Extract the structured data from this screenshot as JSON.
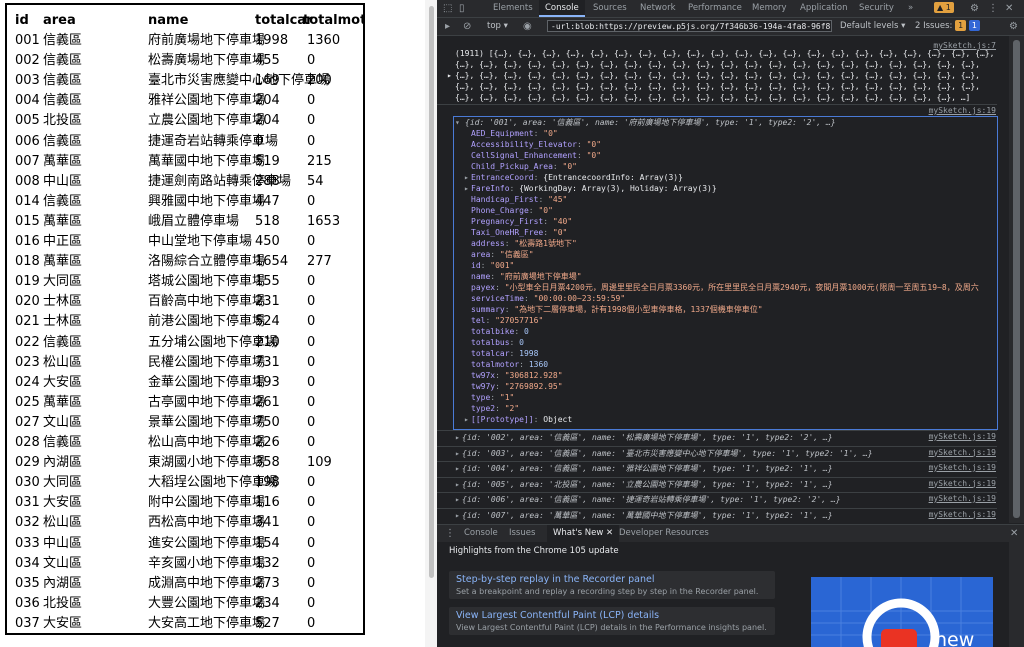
{
  "canvas": {
    "headers": [
      "id",
      "area",
      "name",
      "totalcar",
      "totalmotor"
    ],
    "rows": [
      [
        "001",
        "信義區",
        "府前廣場地下停車場",
        "1998",
        "1360"
      ],
      [
        "002",
        "信義區",
        "松壽廣場地下停車場",
        "455",
        "0"
      ],
      [
        "003",
        "信義區",
        "臺北市災害應變中心地下停車場",
        "169",
        "200"
      ],
      [
        "004",
        "信義區",
        "雅祥公園地下停車場",
        "204",
        "0"
      ],
      [
        "005",
        "北投區",
        "立農公園地下停車場",
        "204",
        "0"
      ],
      [
        "006",
        "信義區",
        "捷運奇岩站轉乘停車場",
        "0",
        "0"
      ],
      [
        "007",
        "萬華區",
        "萬華國中地下停車場",
        "519",
        "215"
      ],
      [
        "008",
        "中山區",
        "捷運劍南路站轉乘停車場",
        "288",
        "54"
      ],
      [
        "014",
        "信義區",
        "興雅國中地下停車場",
        "447",
        "0"
      ],
      [
        "015",
        "萬華區",
        "峨眉立體停車場",
        "518",
        "1653"
      ],
      [
        "016",
        "中正區",
        "中山堂地下停車場",
        "450",
        "0"
      ],
      [
        "018",
        "萬華區",
        "洛陽綜合立體停車場",
        "1654",
        "277"
      ],
      [
        "019",
        "大同區",
        "塔城公園地下停車場",
        "155",
        "0"
      ],
      [
        "020",
        "士林區",
        "百齡高中地下停車場",
        "231",
        "0"
      ],
      [
        "021",
        "士林區",
        "前港公園地下停車場",
        "524",
        "0"
      ],
      [
        "022",
        "信義區",
        "五分埔公園地下停車場",
        "210",
        "0"
      ],
      [
        "023",
        "松山區",
        "民權公園地下停車場",
        "731",
        "0"
      ],
      [
        "024",
        "大安區",
        "金華公園地下停車場",
        "193",
        "0"
      ],
      [
        "025",
        "萬華區",
        "古亭國中地下停車場",
        "261",
        "0"
      ],
      [
        "027",
        "文山區",
        "景華公園地下停車場",
        "750",
        "0"
      ],
      [
        "028",
        "信義區",
        "松山高中地下停車場",
        "226",
        "0"
      ],
      [
        "029",
        "內湖區",
        "東湖國小地下停車場",
        "358",
        "109"
      ],
      [
        "030",
        "大同區",
        "大稻埕公園地下停車場",
        "198",
        "0"
      ],
      [
        "031",
        "大安區",
        "附中公園地下停車場",
        "116",
        "0"
      ],
      [
        "032",
        "松山區",
        "西松高中地下停車場",
        "341",
        "0"
      ],
      [
        "033",
        "中山區",
        "進安公園地下停車場",
        "154",
        "0"
      ],
      [
        "034",
        "文山區",
        "辛亥國小地下停車場",
        "132",
        "0"
      ],
      [
        "035",
        "內湖區",
        "成淵高中地下停車場",
        "273",
        "0"
      ],
      [
        "036",
        "北投區",
        "大豐公園地下停車場",
        "234",
        "0"
      ],
      [
        "037",
        "大安區",
        "大安高工地下停車場",
        "527",
        "0"
      ]
    ]
  },
  "devtools": {
    "tabs": [
      "Elements",
      "Console",
      "Sources",
      "Network",
      "Performance",
      "Memory",
      "Application",
      "Security",
      "»"
    ],
    "active_tab": "Console",
    "warn_count": "1",
    "context": "top",
    "filter_value": "-url:blob:https://preview.p5js.org/7f346b36-194a-4fa8-96f8-c40351b831",
    "levels": "Default levels",
    "issues": "2 Issues:",
    "issues_warn": "1",
    "issues_info": "1",
    "source1": "mySketch.js:7",
    "source2": "mySketch.js:19",
    "array_summary": "(1911) [{…}, {…}, {…}, {…}, {…}, {…}, {…}, {…}, {…}, {…}, {…}, {…}, {…}, {…}, {…}, {…}, {…}, {…}, {…}, {…}, {…},",
    "array_line2": "{…}, {…}, {…}, {…}, {…}, {…}, {…}, {…}, {…}, {…}, {…}, {…}, {…}, {…}, {…}, {…}, {…}, {…}, {…}, {…}, {…}, {…},",
    "array_line3": "{…}, {…}, {…}, {…}, {…}, {…}, {…}, {…}, {…}, {…}, {…}, {…}, {…}, {…}, {…}, {…}, {…}, {…}, {…}, {…}, {…}, {…},",
    "array_line4": "{…}, {…}, {…}, {…}, {…}, {…}, {…}, {…}, {…}, {…}, {…}, {…}, {…}, {…}, {…}, {…}, {…}, {…}, {…}, {…}, {…}, {…},",
    "array_line5": "{…}, {…}, {…}, {…}, {…}, {…}, {…}, {…}, {…}, {…}, {…}, {…}, {…}, {…}, {…}, {…}, {…}, {…}, {…}, {…}, {…}, …]",
    "object_props": [
      [
        "AED_Equipment",
        "\"0\""
      ],
      [
        "Accessibility_Elevator",
        "\"0\""
      ],
      [
        "CellSignal_Enhancement",
        "\"0\""
      ],
      [
        "Child_Pickup_Area",
        "\"0\""
      ],
      [
        "EntranceCoord",
        "{EntrancecoordInfo: Array(3)}"
      ],
      [
        "FareInfo",
        "{WorkingDay: Array(3), Holiday: Array(3)}"
      ],
      [
        "Handicap_First",
        "\"45\""
      ],
      [
        "Phone_Charge",
        "\"0\""
      ],
      [
        "Pregnancy_First",
        "\"40\""
      ],
      [
        "Taxi_OneHR_Free",
        "\"0\""
      ],
      [
        "address",
        "\"松壽路1號地下\""
      ],
      [
        "area",
        "\"信義區\""
      ],
      [
        "id",
        "\"001\""
      ],
      [
        "name",
        "\"府前廣場地下停車場\""
      ],
      [
        "payex",
        "\"小型車全日月票4200元，周邊里里民全日月票3360元，所在里里民全日月票2940元，夜間月票1000元(限周一至周五19~8，及周六"
      ],
      [
        "serviceTime",
        "\"00:00:00~23:59:59\""
      ],
      [
        "summary",
        "\"為地下二層停車場，計有1998個小型車停車格，1337個機車停車位\""
      ],
      [
        "tel",
        "\"27057716\""
      ],
      [
        "totalbike",
        "0"
      ],
      [
        "totalbus",
        "0"
      ],
      [
        "totalcar",
        "1998"
      ],
      [
        "totalmotor",
        "1360"
      ],
      [
        "tw97x",
        "\"306812.928\""
      ],
      [
        "tw97y",
        "\"2769892.95\""
      ],
      [
        "type",
        "\"1\""
      ],
      [
        "type2",
        "\"2\""
      ],
      [
        "[[Prototype]]",
        "Object"
      ]
    ],
    "object_header": "{id: '001', area: '信義區', name: '府前廣場地下停車場', type: '1', type2: '2', …}",
    "collapsed": [
      "{id: '002', area: '信義區', name: '松壽廣場地下停車場', type: '1', type2: '2', …}",
      "{id: '003', area: '信義區', name: '臺北市災害應變中心地下停車場', type: '1', type2: '1', …}",
      "{id: '004', area: '信義區', name: '雅祥公園地下停車場', type: '1', type2: '1', …}",
      "{id: '005', area: '北投區', name: '立農公園地下停車場', type: '1', type2: '1', …}",
      "{id: '006', area: '信義區', name: '捷運奇岩站轉乘停車場', type: '1', type2: '2', …}",
      "{id: '007', area: '萬華區', name: '萬華國中地下停車場', type: '1', type2: '1', …}"
    ],
    "drawer_tabs": [
      "Console",
      "Issues",
      "What's New",
      "Developer Resources"
    ],
    "drawer_active": "What's New",
    "whatsnew_title": "Highlights from the Chrome 105 update",
    "cards": [
      {
        "title": "Step-by-step replay in the Recorder panel",
        "desc": "Set a breakpoint and replay a recording step by step in the Recorder panel."
      },
      {
        "title": "View Largest Contentful Paint (LCP) details",
        "desc": "View Largest Contentful Paint (LCP) details in the Performance insights panel."
      }
    ],
    "art_text": "new"
  }
}
